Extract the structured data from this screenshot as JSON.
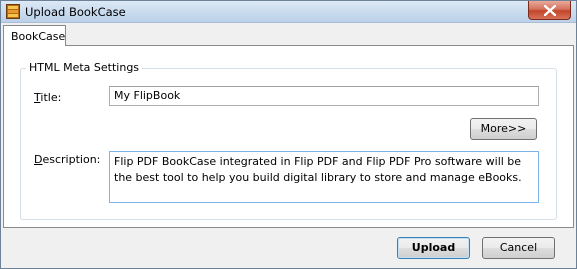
{
  "window": {
    "title": "Upload BookCase",
    "icon": "bookcase-icon",
    "close_icon": "close-icon",
    "close_color": "#c7482c"
  },
  "tabs": [
    {
      "label": "BookCase",
      "selected": true
    }
  ],
  "group": {
    "legend": "HTML Meta Settings"
  },
  "form": {
    "title_label": "Title:",
    "title_value": "My FlipBook",
    "more_button": "More>>",
    "description_label": "Description:",
    "description_value": "Flip PDF BookCase integrated in Flip PDF and Flip PDF Pro software will be the best tool to help you build digital library to store and manage eBooks."
  },
  "footer": {
    "upload_button": "Upload",
    "cancel_button": "Cancel"
  }
}
